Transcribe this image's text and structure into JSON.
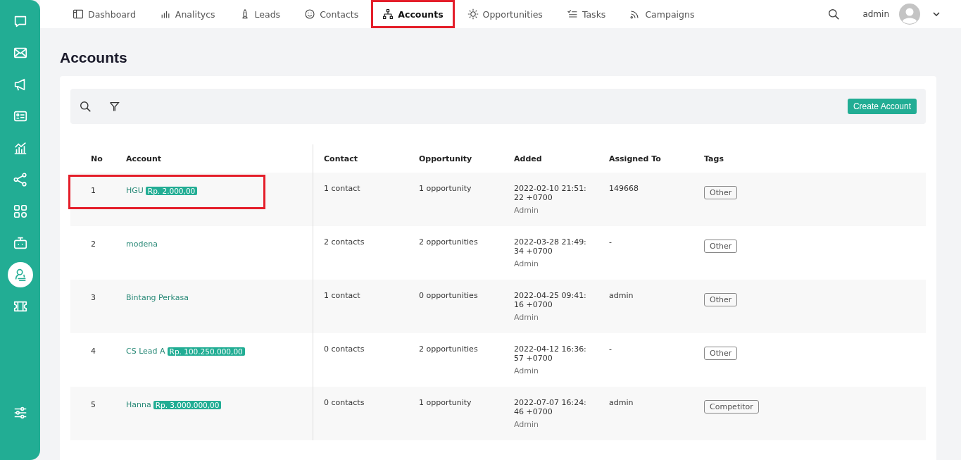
{
  "sidebar": {
    "items": [
      {
        "selected": false
      },
      {
        "selected": false
      },
      {
        "selected": false
      },
      {
        "selected": false
      },
      {
        "selected": false
      },
      {
        "selected": false
      },
      {
        "selected": false
      },
      {
        "selected": false
      },
      {
        "selected": true
      },
      {
        "selected": false
      }
    ]
  },
  "nav": {
    "tabs": [
      {
        "label": "Dashboard",
        "selected": false,
        "highlighted": false
      },
      {
        "label": "Analitycs",
        "selected": false,
        "highlighted": false
      },
      {
        "label": "Leads",
        "selected": false,
        "highlighted": false
      },
      {
        "label": "Contacts",
        "selected": false,
        "highlighted": false
      },
      {
        "label": "Accounts",
        "selected": true,
        "highlighted": true
      },
      {
        "label": "Opportunities",
        "selected": false,
        "highlighted": false
      },
      {
        "label": "Tasks",
        "selected": false,
        "highlighted": false
      },
      {
        "label": "Campaigns",
        "selected": false,
        "highlighted": false
      }
    ],
    "user": "admin"
  },
  "page_title": "Accounts",
  "toolbar": {
    "create_button": "Create Account"
  },
  "table": {
    "columns": [
      "No",
      "Account",
      "Contact",
      "Opportunity",
      "Added",
      "Assigned To",
      "Tags"
    ],
    "rows": [
      {
        "no": "1",
        "account": "HGU",
        "amount": "Rp. 2.000,00",
        "contact": "1 contact",
        "opportunity": "1 opportunity",
        "added": "2022-02-10 21:51:22 +0700",
        "added_by": "Admin",
        "assigned": "149668",
        "tag": "Other",
        "highlighted": true
      },
      {
        "no": "2",
        "account": "modena",
        "contact": "2 contacts",
        "opportunity": "2 opportunities",
        "added": "2022-03-28 21:49:34 +0700",
        "added_by": "Admin",
        "assigned": "-",
        "tag": "Other",
        "highlighted": false
      },
      {
        "no": "3",
        "account": "Bintang Perkasa",
        "contact": "1 contact",
        "opportunity": "0 opportunities",
        "added": "2022-04-25 09:41:16 +0700",
        "added_by": "Admin",
        "assigned": "admin",
        "tag": "Other",
        "highlighted": false
      },
      {
        "no": "4",
        "account": "CS Lead A",
        "amount": "Rp. 100.250.000,00",
        "contact": "0 contacts",
        "opportunity": "2 opportunities",
        "added": "2022-04-12 16:36:57 +0700",
        "added_by": "Admin",
        "assigned": "-",
        "tag": "Other",
        "highlighted": false
      },
      {
        "no": "5",
        "account": "Hanna",
        "amount": "Rp. 3.000.000,00",
        "contact": "0 contacts",
        "opportunity": "1 opportunity",
        "added": "2022-07-07 16:24:46 +0700",
        "added_by": "Admin",
        "assigned": "admin",
        "tag": "Competitor",
        "highlighted": false
      }
    ]
  }
}
